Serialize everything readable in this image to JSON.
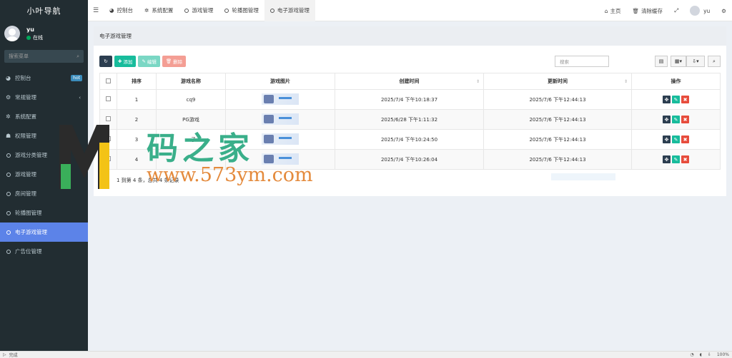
{
  "brand": "小叶导航",
  "user": {
    "name": "yu",
    "status": "在线"
  },
  "sidebar": {
    "search_placeholder": "搜索菜单",
    "items": [
      {
        "label": "控制台",
        "icon": "dashboard-icon",
        "badge": "hot"
      },
      {
        "label": "常规管理",
        "icon": "cogs-icon",
        "chevron": "‹"
      },
      {
        "label": "系统配置",
        "icon": "gear-icon"
      },
      {
        "label": "权限管理",
        "icon": "users-icon"
      },
      {
        "label": "游戏分类管理",
        "icon": "circle-icon"
      },
      {
        "label": "游戏管理",
        "icon": "circle-icon"
      },
      {
        "label": "房间管理",
        "icon": "circle-icon"
      },
      {
        "label": "轮播图管理",
        "icon": "circle-icon"
      },
      {
        "label": "电子游戏管理",
        "icon": "circle-icon",
        "active": true
      },
      {
        "label": "广告位管理",
        "icon": "circle-icon"
      }
    ]
  },
  "topbar": {
    "tabs": [
      {
        "label": "控制台"
      },
      {
        "label": "系统配置"
      },
      {
        "label": "游戏管理"
      },
      {
        "label": "轮播图管理"
      },
      {
        "label": "电子游戏管理",
        "active": true
      }
    ],
    "home": "主页",
    "clear_cache": "清除缓存",
    "username": "yu"
  },
  "page": {
    "title": "电子游戏管理",
    "buttons": {
      "add": "添加",
      "edit": "编辑",
      "delete": "删除"
    },
    "search_placeholder": "搜索",
    "table": {
      "headers": [
        "排序",
        "游戏名称",
        "游戏图片",
        "创建时间",
        "更新时间",
        "操作"
      ],
      "rows": [
        {
          "sort": "1",
          "name": "cq9",
          "created": "2025/7/4 下午10:18:37",
          "updated": "2025/7/6 下午12:44:13"
        },
        {
          "sort": "2",
          "name": "PG游戏",
          "created": "2025/6/28 下午1:11:32",
          "updated": "2025/7/6 下午12:44:13"
        },
        {
          "sort": "3",
          "name": "…子",
          "created": "2025/7/4 下午10:24:50",
          "updated": "2025/7/6 下午12:44:13"
        },
        {
          "sort": "4",
          "name": "",
          "created": "2025/7/4 下午10:26:04",
          "updated": "2025/7/6 下午12:44:13"
        }
      ]
    },
    "pagination_text": "1 到第 4 条，总共 4 条记录"
  },
  "watermark": {
    "cn": "码之家",
    "url": "www.573ym.com"
  },
  "statusbar": {
    "left": "完成",
    "zoom": "100%"
  },
  "colors": {
    "sidebar_bg": "#222d32",
    "active_menu": "#5c83e8",
    "success": "#18bc9c",
    "danger": "#e74c3c",
    "dark": "#2c3e50"
  }
}
